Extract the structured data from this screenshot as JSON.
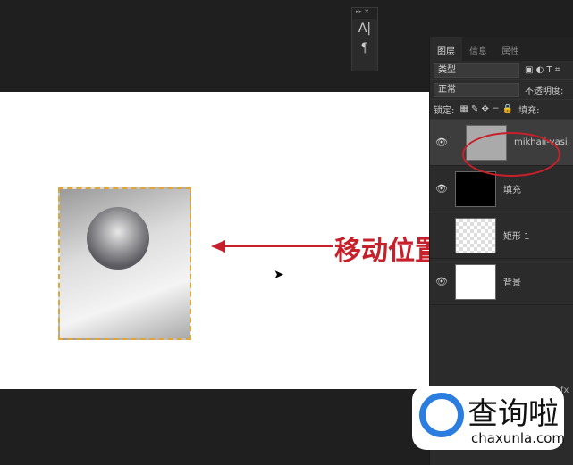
{
  "mini_panel": {
    "tools": [
      "A|",
      "¶"
    ]
  },
  "panel": {
    "tabs": [
      "图层",
      "信息",
      "属性"
    ],
    "filter": "类型",
    "blend": "正常",
    "opacity_label": "不透明度:",
    "lock_label": "锁定:",
    "fill_label": "填充:",
    "layers": [
      {
        "name": "mikhail-vasi",
        "active": true
      },
      {
        "name": "填充"
      },
      {
        "name": "矩形 1"
      },
      {
        "name": "背景"
      }
    ],
    "fx": "fx"
  },
  "annotation": {
    "text": "移动位置",
    "color": "#c8202a"
  },
  "watermark": {
    "cn": "查询啦",
    "en": "chaxunla.com"
  }
}
